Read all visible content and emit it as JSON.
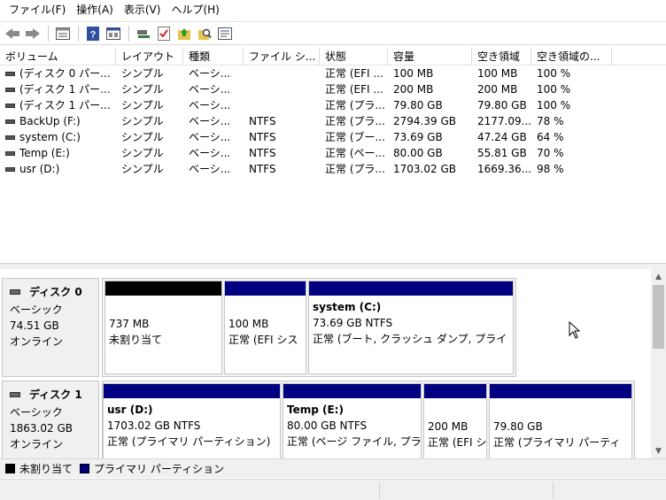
{
  "menu": [
    "ファイル(F)",
    "操作(A)",
    "表示(V)",
    "ヘルプ(H)"
  ],
  "toolbar_icons": [
    "back-arrow-icon",
    "forward-arrow-icon",
    "disk-list-icon",
    "help-icon",
    "console-icon",
    "connect-icon",
    "checkmark-icon",
    "up-folder-icon",
    "search-icon",
    "properties-icon"
  ],
  "volume_list": {
    "columns": [
      "ボリューム",
      "レイアウト",
      "種類",
      "ファイル シ...",
      "状態",
      "容量",
      "空き領域",
      "空き領域の..."
    ],
    "rows": [
      [
        "(ディスク 0 パー...",
        "シンプル",
        "ベーシ...",
        "",
        "正常 (EFI ...",
        "100 MB",
        "100 MB",
        "100 %"
      ],
      [
        "(ディスク 1 パー...",
        "シンプル",
        "ベーシ...",
        "",
        "正常 (EFI ...",
        "200 MB",
        "200 MB",
        "100 %"
      ],
      [
        "(ディスク 1 パー...",
        "シンプル",
        "ベーシ...",
        "",
        "正常 (プラ...",
        "79.80 GB",
        "79.80 GB",
        "100 %"
      ],
      [
        "BackUp (F:)",
        "シンプル",
        "ベーシ...",
        "NTFS",
        "正常 (プラ...",
        "2794.39 GB",
        "2177.09...",
        "78 %"
      ],
      [
        "system (C:)",
        "シンプル",
        "ベーシ...",
        "NTFS",
        "正常 (ブー...",
        "73.69 GB",
        "47.24 GB",
        "64 %"
      ],
      [
        "Temp (E:)",
        "シンプル",
        "ベーシ...",
        "NTFS",
        "正常 (ペー...",
        "80.00 GB",
        "55.81 GB",
        "70 %"
      ],
      [
        "usr (D:)",
        "シンプル",
        "ベーシ...",
        "NTFS",
        "正常 (プラ...",
        "1703.02 GB",
        "1669.36...",
        "98 %"
      ]
    ]
  },
  "disks": [
    {
      "name": "ディスク 0",
      "type": "ベーシック",
      "size": "74.51 GB",
      "status": "オンライン",
      "partitions": [
        {
          "name": "",
          "size": "737 MB",
          "desc": "未割り当て",
          "kind": "unallocated"
        },
        {
          "name": "",
          "size": "100 MB",
          "desc": "正常 (EFI シス",
          "kind": "primary"
        },
        {
          "name": "system  (C:)",
          "size": "73.69 GB NTFS",
          "desc": "正常 (ブート, クラッシュ ダンプ, プライ",
          "kind": "primary"
        }
      ]
    },
    {
      "name": "ディスク 1",
      "type": "ベーシック",
      "size": "1863.02 GB",
      "status": "オンライン",
      "partitions": [
        {
          "name": "usr  (D:)",
          "size": "1703.02 GB NTFS",
          "desc": "正常 (プライマリ パーティション)",
          "kind": "primary"
        },
        {
          "name": "Temp  (E:)",
          "size": "80.00 GB NTFS",
          "desc": "正常 (ページ ファイル, プラ",
          "kind": "primary"
        },
        {
          "name": "",
          "size": "200 MB",
          "desc": "正常 (EFI シ",
          "kind": "primary"
        },
        {
          "name": "",
          "size": "79.80 GB",
          "desc": "正常 (プライマリ パーティ",
          "kind": "primary"
        }
      ]
    }
  ],
  "legend": [
    "未割り当て",
    "プライマリ パーティション"
  ],
  "colors": {
    "primary": "#000080",
    "unallocated": "#000000",
    "toolbar_blue": "#2e4fa3"
  }
}
